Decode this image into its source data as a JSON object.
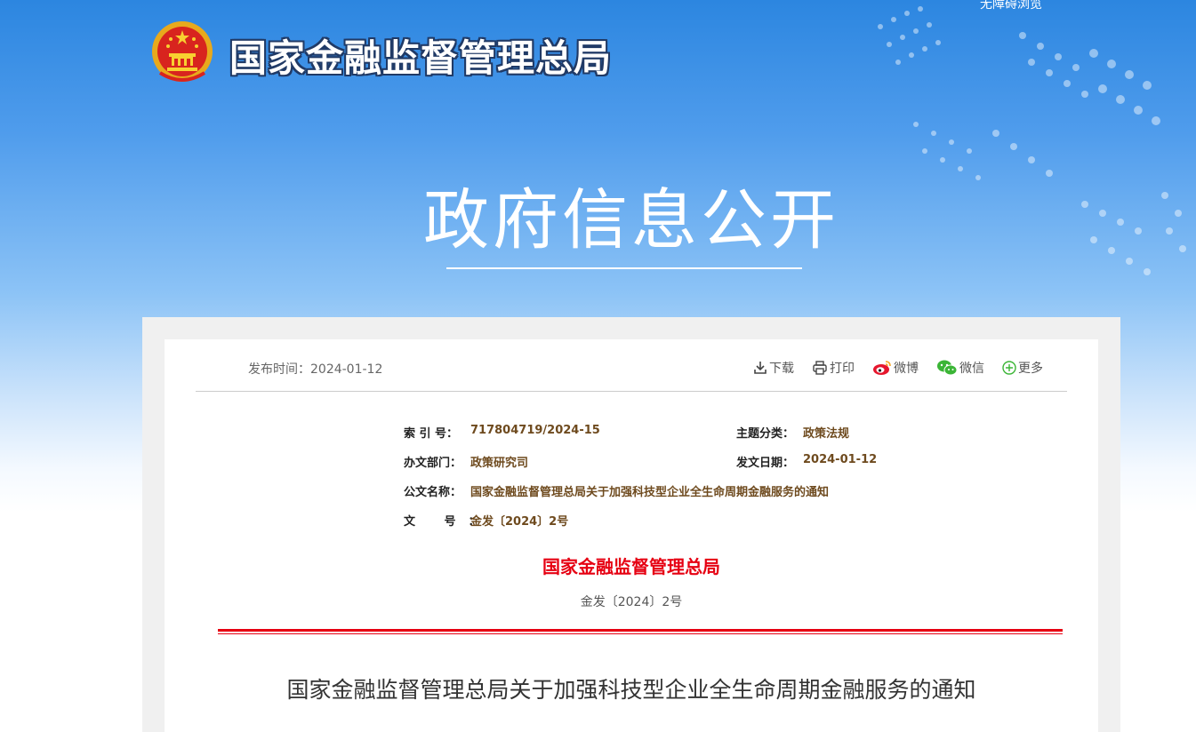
{
  "header": {
    "accessibility_link": "无障碍浏览",
    "site_title": "国家金融监督管理总局",
    "section_title": "政府信息公开"
  },
  "meta": {
    "publish_label": "发布时间：",
    "publish_date": "2024-01-12"
  },
  "tools": {
    "download": "下载",
    "print": "打印",
    "weibo": "微博",
    "wechat": "微信",
    "more": "更多"
  },
  "info": {
    "index_label": "索 引 号：",
    "index_value": "717804719/2024-15",
    "topic_label": "主题分类：",
    "topic_value": "政策法规",
    "dept_label": "办文部门：",
    "dept_value": "政策研究司",
    "date_label": "发文日期：",
    "date_value": "2024-01-12",
    "name_label": "公文名称：",
    "name_value": "国家金融监督管理总局关于加强科技型企业全生命周期金融服务的通知",
    "docno_label": "文 号：",
    "docno_value": "金发〔2024〕2号"
  },
  "document": {
    "issuer": "国家金融监督管理总局",
    "number": "金发〔2024〕2号",
    "title": "国家金融监督管理总局关于加强科技型企业全生命周期金融服务的通知"
  },
  "colors": {
    "banner_blue": "#2c86e0",
    "red": "#e60012",
    "value_brown": "#6e4a1e"
  }
}
